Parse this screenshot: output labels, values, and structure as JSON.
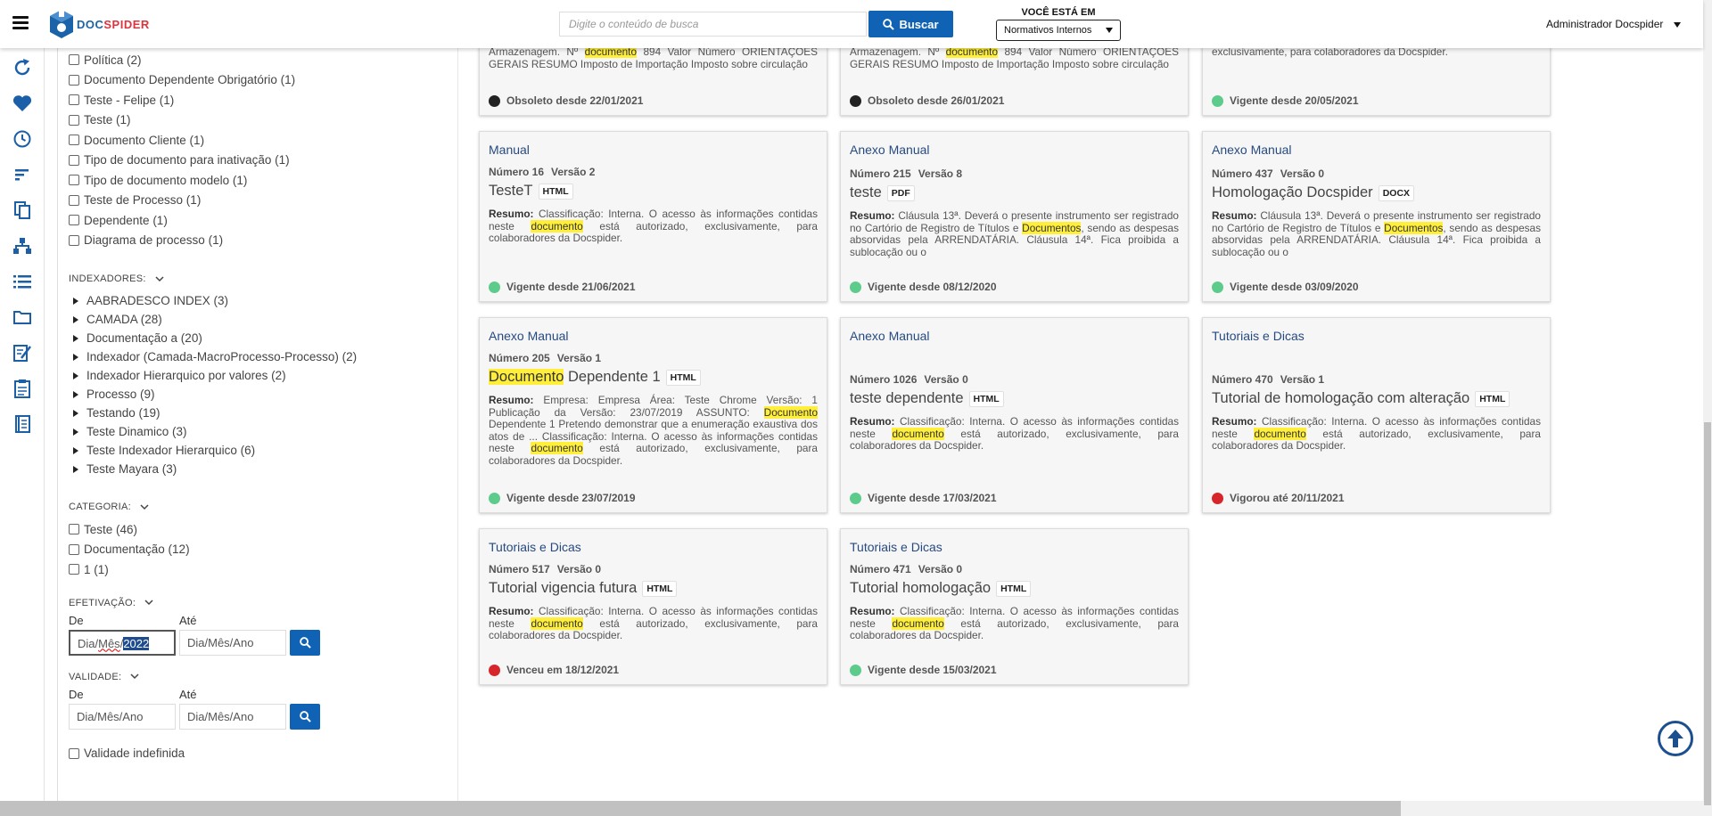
{
  "header": {
    "logo_text_a": "DOC",
    "logo_text_b": "SPIDER",
    "search_placeholder": "Digite o conteúdo de busca",
    "search_button": "Buscar",
    "context_label": "VOCÊ ESTÁ EM",
    "context_value": "Normativos Internos",
    "user_name": "Administrador Docspider"
  },
  "rail": [
    "refresh-icon",
    "heart-icon",
    "clock-icon",
    "sort-icon",
    "copy-icon",
    "hierarchy-icon",
    "list-icon",
    "folder-icon",
    "edit-icon",
    "clipboard-icon",
    "notebook-icon"
  ],
  "filters": {
    "types": [
      "Política (2)",
      "Documento Dependente Obrigatório (1)",
      "Teste - Felipe (1)",
      "Teste (1)",
      "Documento Cliente (1)",
      "Tipo de documento para inativação (1)",
      "Tipo de documento modelo (1)",
      "Teste de Processo (1)",
      "Dependente (1)",
      "Diagrama de processo (1)"
    ],
    "indexers_label": "INDEXADORES:",
    "indexers": [
      "AABRADESCO INDEX (3)",
      "CAMADA (28)",
      "Documentação a (20)",
      "Indexador (Camada-MacroProcesso-Processo) (2)",
      "Indexador Hierarquico por valores (2)",
      "Processo (9)",
      "Testando (19)",
      "Teste Dinamico (3)",
      "Teste Indexador Hierarquico (6)",
      "Teste Mayara (3)"
    ],
    "category_label": "CATEGORIA:",
    "categories": [
      "Teste (46)",
      "Documentação (12)",
      "1 (1)"
    ],
    "effective_label": "EFETIVAÇÃO:",
    "from_label": "De",
    "to_label": "Até",
    "effective_from_prefix": "Dia/",
    "effective_from_mid": "Mês",
    "effective_from_sep": "/",
    "effective_from_year": "2022",
    "date_placeholder": "Dia/Mês/Ano",
    "validity_label": "VALIDADE:",
    "indefinite_label": "Validade indefinida"
  },
  "cards_top": [
    {
      "text_a": "Armazenagem. Nº ",
      "hl": "documento",
      "text_b": " 894 Valor Número ORIENTAÇÕES GERAIS RESUMO Imposto de Importação Imposto sobre circulação",
      "status": "Obsoleto desde 22/01/2021",
      "status_color": "black"
    },
    {
      "text_a": "Armazenagem. Nº ",
      "hl": "documento",
      "text_b": " 894 Valor Número ORIENTAÇÕES GERAIS RESUMO Imposto de Importação Imposto sobre circulação",
      "status": "Obsoleto desde 26/01/2021",
      "status_color": "black"
    },
    {
      "text_a": "exclusivamente, para colaboradores da Docspider.",
      "hl": "",
      "text_b": "",
      "status": "Vigente desde 20/05/2021",
      "status_color": "green"
    }
  ],
  "summary_label": "Resumo:",
  "cards": [
    {
      "category": "Manual",
      "number": "Número 16",
      "version": "Versão 2",
      "title_hl": "",
      "title": "TesteT",
      "badge": "HTML",
      "s1": " Classificação: Interna. O acesso às informações contidas neste ",
      "h1": "documento",
      "s2": " está autorizado, exclusivamente, para colaboradores da Docspider.",
      "h2": "",
      "s3": "",
      "h3": "",
      "s4": "",
      "status": "Vigente desde 21/06/2021",
      "status_color": "green"
    },
    {
      "category": "Anexo Manual",
      "number": "Número 215",
      "version": "Versão 8",
      "title_hl": "",
      "title": "teste",
      "badge": "PDF",
      "s1": " Cláusula 13ª. Deverá o presente instrumento ser registrado no Cartório de Registro de Títulos e ",
      "h1": "Documentos",
      "s2": ", sendo as despesas absorvidas pela ARRENDATÁRIA. Cláusula 14ª. Fica proibida a sublocação ou o",
      "h2": "",
      "s3": "",
      "h3": "",
      "s4": "",
      "status": "Vigente desde 08/12/2020",
      "status_color": "green"
    },
    {
      "category": "Anexo Manual",
      "number": "Número 437",
      "version": "Versão 0",
      "title_hl": "",
      "title": "Homologação Docspider",
      "badge": "DOCX",
      "s1": " Cláusula 13ª. Deverá o presente instrumento ser registrado no Cartório de Registro de Títulos e ",
      "h1": "Documentos",
      "s2": ", sendo as despesas absorvidas pela ARRENDATÁRIA. Cláusula 14ª. Fica proibida a sublocação ou o",
      "h2": "",
      "s3": "",
      "h3": "",
      "s4": "",
      "status": "Vigente desde 03/09/2020",
      "status_color": "green"
    },
    {
      "category": "Anexo Manual",
      "number": "Número 205",
      "version": "Versão 1",
      "title_hl": "Documento",
      "title": " Dependente 1",
      "badge": "HTML",
      "s1": " Empresa: Empresa Área: Teste Chrome Versão: 1 Publicação da Versão: 23/07/2019 ASSUNTO: ",
      "h1": "Documento",
      "s2": " Dependente 1 Pretendo demonstrar que a enumeração exaustiva dos atos de ... Classificação: Interna. O acesso às informações contidas neste ",
      "h2": "documento",
      "s3": " está autorizado, exclusivamente, para colaboradores da Docspider.",
      "h3": "",
      "s4": "",
      "status": "Vigente desde 23/07/2019",
      "status_color": "green"
    },
    {
      "category": "Anexo Manual",
      "number": "Número 1026",
      "version": "Versão 0",
      "title_hl": "",
      "title": "teste dependente",
      "badge": "HTML",
      "s1": " Classificação: Interna. O acesso às informações contidas neste ",
      "h1": "documento",
      "s2": " está autorizado, exclusivamente, para colaboradores da Docspider.",
      "h2": "",
      "s3": "",
      "h3": "",
      "s4": "",
      "status": "Vigente desde 17/03/2021",
      "status_color": "green"
    },
    {
      "category": "Tutoriais e Dicas",
      "number": "Número 470",
      "version": "Versão 1",
      "title_hl": "",
      "title": "Tutorial de homologação com alteração",
      "badge": "HTML",
      "s1": " Classificação: Interna. O acesso às informações contidas neste ",
      "h1": "documento",
      "s2": " está autorizado, exclusivamente, para colaboradores da Docspider.",
      "h2": "",
      "s3": "",
      "h3": "",
      "s4": "",
      "status": "Vigorou até 20/11/2021",
      "status_color": "red"
    },
    {
      "category": "Tutoriais e Dicas",
      "number": "Número 517",
      "version": "Versão 0",
      "title_hl": "",
      "title": "Tutorial vigencia futura",
      "badge": "HTML",
      "s1": " Classificação: Interna. O acesso às informações contidas neste ",
      "h1": "documento",
      "s2": " está autorizado, exclusivamente, para colaboradores da Docspider.",
      "h2": "",
      "s3": "",
      "h3": "",
      "s4": "",
      "status": "Venceu em 18/12/2021",
      "status_color": "red"
    },
    {
      "category": "Tutoriais e Dicas",
      "number": "Número 471",
      "version": "Versão 0",
      "title_hl": "",
      "title": "Tutorial homologação",
      "badge": "HTML",
      "s1": " Classificação: Interna. O acesso às informações contidas neste ",
      "h1": "documento",
      "s2": " está autorizado, exclusivamente, para colaboradores da Docspider.",
      "h2": "",
      "s3": "",
      "h3": "",
      "s4": "",
      "status": "Vigente desde 15/03/2021",
      "status_color": "green"
    }
  ]
}
